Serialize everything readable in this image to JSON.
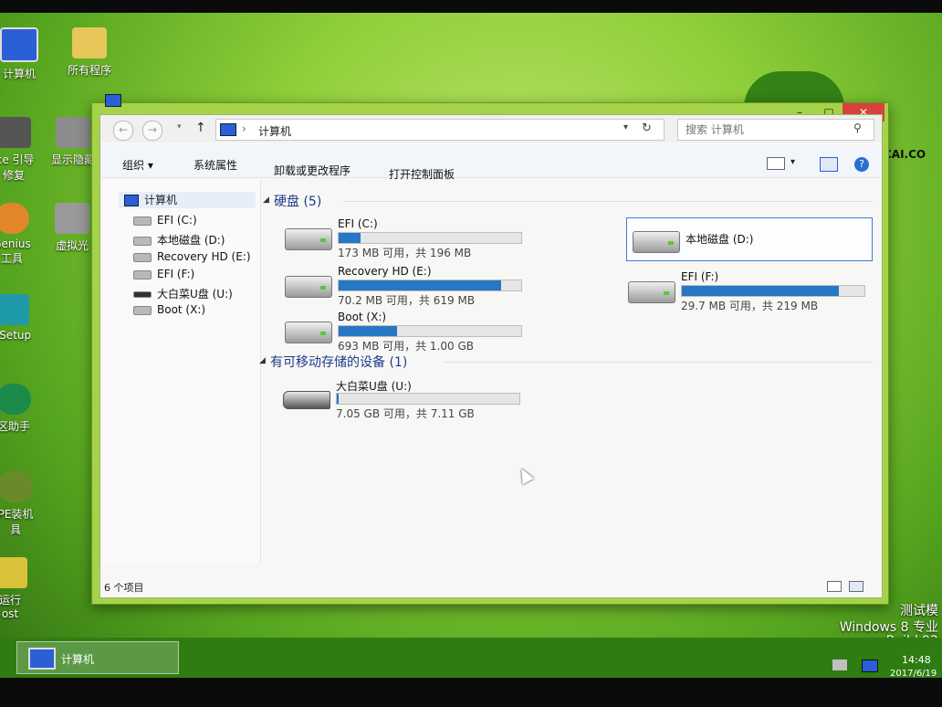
{
  "desktop": {
    "icons": [
      {
        "label": "计算机"
      },
      {
        "label": "所有程序"
      },
      {
        "label": "ice 引导"
      },
      {
        "label": "修复"
      },
      {
        "label": "显示隐藏"
      },
      {
        "label": "Genius"
      },
      {
        "label": "工具"
      },
      {
        "label": "虚拟光"
      },
      {
        "label": "TSetup"
      },
      {
        "label": "区助手"
      },
      {
        "label": "PE装机"
      },
      {
        "label": "具"
      },
      {
        "label": "运行"
      },
      {
        "label": "ost"
      }
    ],
    "brand_text": "CAI.CO",
    "watermark": {
      "line1": "测试模",
      "line2": "Windows 8 专业",
      "line3": "Build 92"
    }
  },
  "window": {
    "title": "计算机",
    "min": "–",
    "max": "□",
    "close": "✕",
    "address": {
      "back": "←",
      "forward": "→",
      "up": "↑",
      "path": "计算机",
      "refresh": "↻"
    },
    "search": {
      "placeholder": "搜索 计算机"
    },
    "toolbar": {
      "organize": "组织 ▾",
      "sys_props": "系统属性",
      "uninstall": "卸载或更改程序",
      "control_panel": "打开控制面板"
    },
    "nav": {
      "root": "计算机",
      "items": [
        {
          "label": "EFI (C:)"
        },
        {
          "label": "本地磁盘 (D:)"
        },
        {
          "label": "Recovery HD (E:)"
        },
        {
          "label": "EFI (F:)"
        },
        {
          "label": "大白菜U盘 (U:)"
        },
        {
          "label": "Boot (X:)"
        }
      ]
    },
    "groups": {
      "hdd": "硬盘 (5)",
      "removable": "有可移动存储的设备 (1)"
    },
    "drives": [
      {
        "name": "EFI (C:)",
        "info": "173 MB 可用，共 196 MB",
        "used_fraction": 0.12
      },
      {
        "name": "本地磁盘 (D:)",
        "info": "",
        "used_fraction": null
      },
      {
        "name": "Recovery HD (E:)",
        "info": "70.2 MB 可用，共 619 MB",
        "used_fraction": 0.89
      },
      {
        "name": "EFI (F:)",
        "info": "29.7 MB 可用，共 219 MB",
        "used_fraction": 0.86
      },
      {
        "name": "Boot (X:)",
        "info": "693 MB 可用，共 1.00 GB",
        "used_fraction": 0.32
      },
      {
        "name": "大白菜U盘 (U:)",
        "info": "7.05 GB 可用，共 7.11 GB",
        "used_fraction": 0.01
      }
    ],
    "status": "6 个项目"
  },
  "taskbar": {
    "task": "计算机",
    "time": "14:48",
    "date": "2017/6/19"
  },
  "colors": {
    "accent": "#2678c4",
    "desktop": "#8fcf3a",
    "close": "#d8413c"
  }
}
